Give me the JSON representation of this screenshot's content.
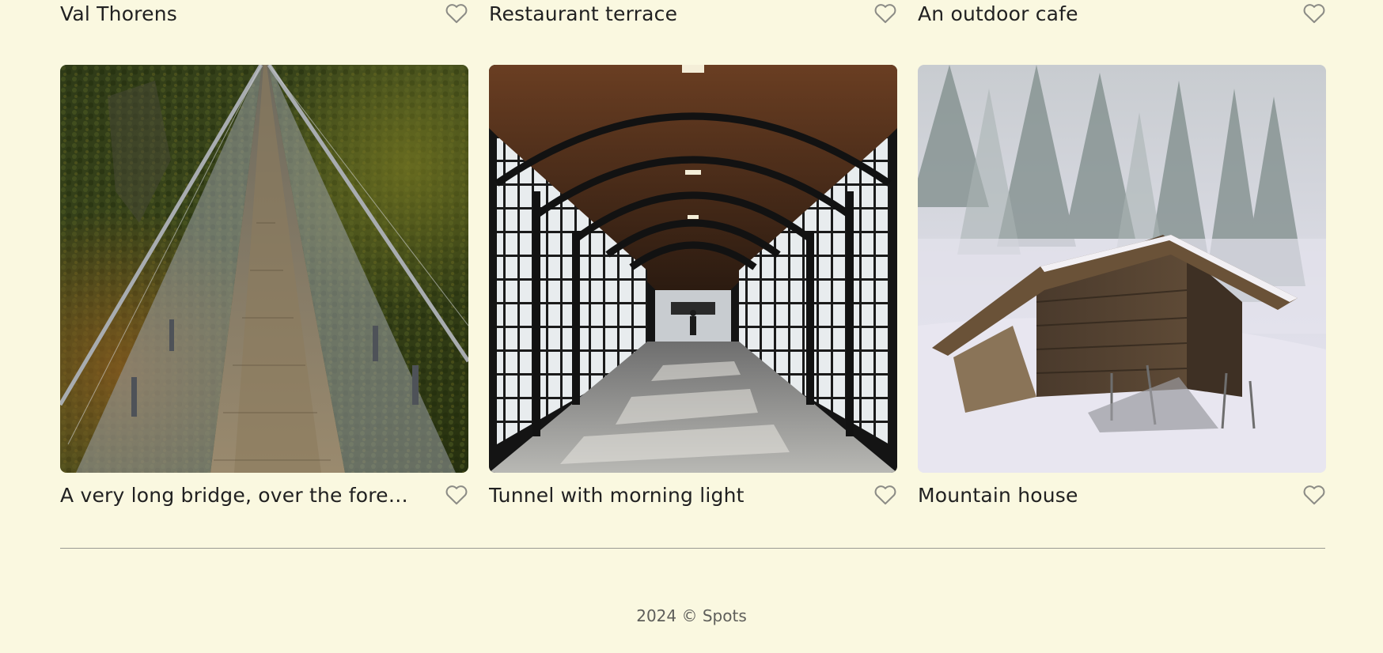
{
  "cards_top": [
    {
      "title": "Val Thorens",
      "like_icon": "heart-outline-icon"
    },
    {
      "title": "Restaurant terrace",
      "like_icon": "heart-outline-icon"
    },
    {
      "title": "An outdoor cafe",
      "like_icon": "heart-outline-icon"
    }
  ],
  "cards_bottom": [
    {
      "title": "A very long bridge, over the forest...",
      "image": "suspension bridge over forest",
      "like_icon": "heart-outline-icon"
    },
    {
      "title": "Tunnel with morning light",
      "image": "glass-walled corridor with wooden arched ceiling",
      "like_icon": "heart-outline-icon"
    },
    {
      "title": "Mountain house",
      "image": "wooden barn in snowy foggy forest",
      "like_icon": "heart-outline-icon"
    }
  ],
  "footer": {
    "copyright": "2024 © Spots"
  },
  "colors": {
    "background": "#FAF8E0",
    "text": "#212121",
    "divider": "#9A9A92",
    "heart": "#8C8C86"
  }
}
